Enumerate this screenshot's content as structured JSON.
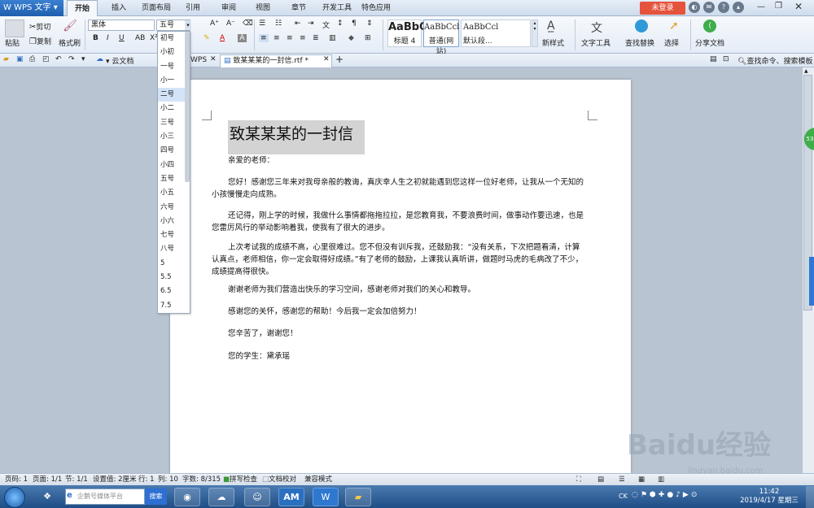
{
  "app": {
    "name": "WPS 文字"
  },
  "tabs": [
    {
      "label": "开始"
    },
    {
      "label": "插入"
    },
    {
      "label": "页面布局"
    },
    {
      "label": "引用"
    },
    {
      "label": "审阅"
    },
    {
      "label": "视图"
    },
    {
      "label": "章节"
    },
    {
      "label": "开发工具"
    },
    {
      "label": "特色应用"
    }
  ],
  "login_label": "未登录",
  "ribbon": {
    "paste": "粘贴",
    "cut": "剪切",
    "copy": "复制",
    "format_painter": "格式刷",
    "font_name": "黑体",
    "font_size": "五号",
    "styles": [
      {
        "preview": "AaBbC",
        "name": "标题 4"
      },
      {
        "preview": "AaBbCcl",
        "name": "普通(网站)"
      },
      {
        "preview": "AaBbCcl",
        "name": "默认段..."
      }
    ],
    "new_style": "新样式",
    "text_tools": "文字工具",
    "find_replace": "查找替换",
    "select": "选择",
    "share": "分享文档"
  },
  "quickbar": {
    "cloud": "云文档",
    "wps_tab": "WPS",
    "doc_tab": "致某某某的一封信.rtf *",
    "search_placeholder": "查找命令、搜索模板"
  },
  "font_size_options": [
    "初号",
    "小初",
    "一号",
    "小一",
    "二号",
    "小二",
    "三号",
    "小三",
    "四号",
    "小四",
    "五号",
    "小五",
    "六号",
    "小六",
    "七号",
    "八号",
    "5",
    "5.5",
    "6.5",
    "7.5"
  ],
  "selected_size_option": "二号",
  "document": {
    "title": "致某某某的一封信",
    "greeting": "亲爱的老师：",
    "paragraphs": [
      "您好！感谢您三年来对我母亲般的教诲，真庆幸人生之初就能遇到您这样一位好老师，让我从一个无知的小孩慢慢走向成熟。",
      "还记得，刚上学的时候，我做什么事情都拖拖拉拉，是您教育我，不要浪费时间，做事动作要迅速，也是您雷厉风行的举动影响着我，使我有了很大的进步。",
      "上次考试我的成绩不高，心里很难过。您不但没有训斥我，还鼓励我：“没有关系，下次把题看清，计算认真点，老师相信，你一定会取得好成绩。”有了老师的鼓励，上课我认真听讲，做题时马虎的毛病改了不少，成绩提高得很快。",
      "谢谢老师为我们营造出快乐的学习空间，感谢老师对我们的关心和教导。",
      "感谢您的关怀，感谢您的帮助！今后我一定会加倍努力！",
      "您辛苦了，谢谢您！",
      "您的学生：黛承瑶"
    ]
  },
  "statusbar": {
    "page": "页码: 1",
    "pages": "页面: 1/1",
    "section": "节: 1/1",
    "setting": "设置值: 2厘米",
    "row": "行: 1",
    "col": "列: 10",
    "words": "字数: 8/315",
    "spell": "拼写检查",
    "proof": "文档校对",
    "compat": "兼容模式"
  },
  "taskbar": {
    "search_placeholder": "企鹅号媒体平台",
    "search_button": "搜索",
    "am": "AM",
    "ck": "CK",
    "time": "11:42",
    "date": "2019/4/17 星期三"
  },
  "watermark": {
    "brand": "Baidu经验",
    "site": "jingyan.baidu.com"
  },
  "side_badge": "53",
  "colors": {
    "accent": "#2f78d0",
    "login": "#e5533d",
    "selection": "#d3d3d3"
  }
}
